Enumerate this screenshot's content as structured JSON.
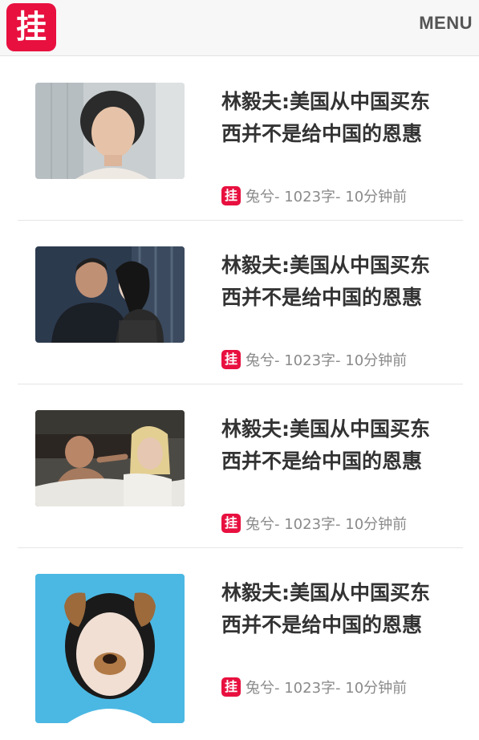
{
  "header": {
    "logo_char": "挂",
    "menu_label": "MENU"
  },
  "articles": [
    {
      "title": "林毅夫:美国从中国买东西并不是给中国的恩惠",
      "logo_char": "挂",
      "meta": "兔兮- 1023字- 10分钟前"
    },
    {
      "title": "林毅夫:美国从中国买东西并不是给中国的恩惠",
      "logo_char": "挂",
      "meta": "兔兮- 1023字- 10分钟前"
    },
    {
      "title": "林毅夫:美国从中国买东西并不是给中国的恩惠",
      "logo_char": "挂",
      "meta": "兔兮- 1023字- 10分钟前"
    },
    {
      "title": "林毅夫:美国从中国买东西并不是给中国的恩惠",
      "logo_char": "挂",
      "meta": "兔兮- 1023字- 10分钟前"
    }
  ],
  "colors": {
    "brand": "#e8103f",
    "title_text": "#333333",
    "meta_text": "#8a8a8a"
  }
}
